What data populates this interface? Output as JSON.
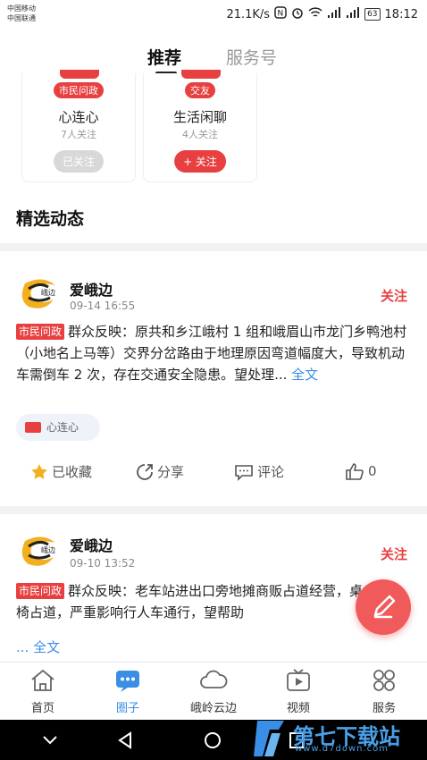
{
  "status_bar": {
    "carrier1": "中国移动",
    "carrier2": "中国联通",
    "speed": "21.1K/s",
    "battery": "63",
    "time": "18:12"
  },
  "top_tabs": {
    "recommend": "推荐",
    "service": "服务号"
  },
  "cards": [
    {
      "tag": "市民问政",
      "name": "心连心",
      "followers": "7人关注",
      "button": "已关注"
    },
    {
      "tag": "交友",
      "name": "生活闲聊",
      "followers": "4人关注",
      "button": "+ 关注"
    }
  ],
  "section_title": "精选动态",
  "posts": [
    {
      "author": "爱峨边",
      "time": "09-14 16:55",
      "follow": "关注",
      "badge": "市民问政",
      "text": "群众反映：原共和乡江峨村 1 组和峨眉山市龙门乡鸭池村（小地名上马等）交界分岔路由于地理原因弯道幅度大，导致机动车需倒车 2 次，存在交通安全隐患。望处理...",
      "more": "全文",
      "topic": "心连心",
      "actions": {
        "collect": "已收藏",
        "share": "分享",
        "comment": "评论",
        "like": "0"
      }
    },
    {
      "author": "爱峨边",
      "time": "09-10 13:52",
      "follow": "关注",
      "badge": "市民问政",
      "text": "群众反映：老车站进出口旁地摊商贩占道经营，桌椅占道，严重影响行人车通行，望帮助",
      "more": "全文"
    }
  ],
  "avatar_text": "峨边",
  "bottom_nav": [
    {
      "label": "首页",
      "icon": "home-icon"
    },
    {
      "label": "圈子",
      "icon": "chat-icon"
    },
    {
      "label": "峨岭云边",
      "icon": "cloud-icon"
    },
    {
      "label": "视频",
      "icon": "video-icon"
    },
    {
      "label": "服务",
      "icon": "grid-icon"
    }
  ],
  "watermark": {
    "text": "第七下载站",
    "url": "www.d7down.com"
  },
  "colors": {
    "accent": "#e84040",
    "link": "#3a8ee6",
    "active_nav": "#3a8ee6"
  }
}
